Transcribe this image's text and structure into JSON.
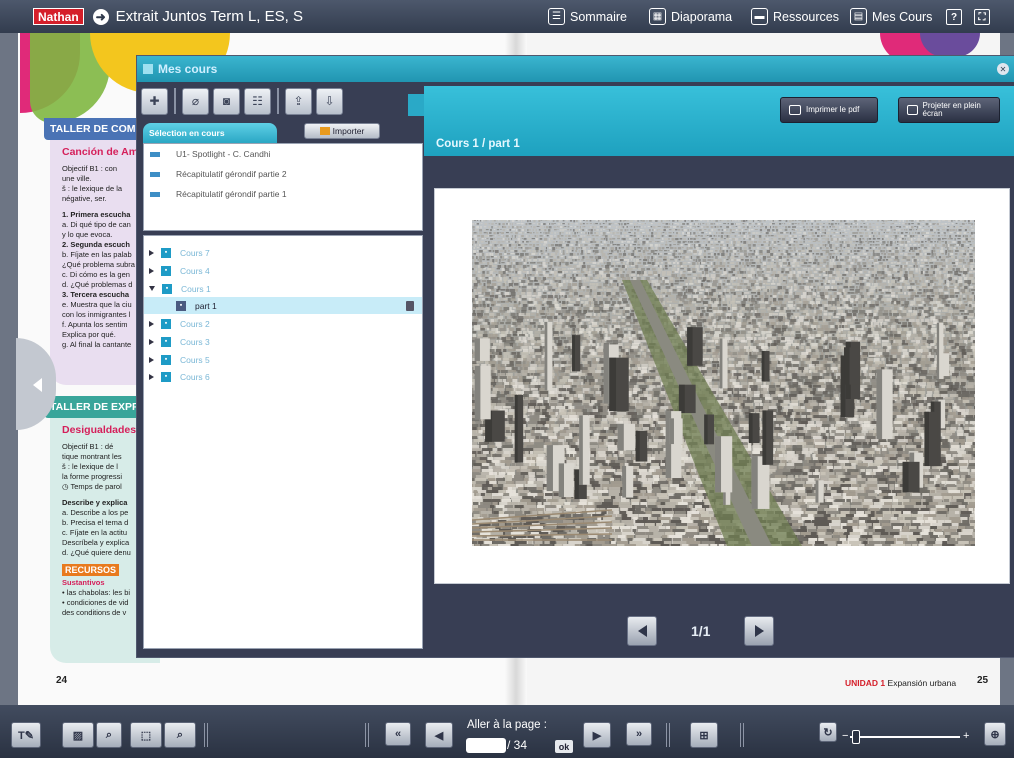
{
  "topbar": {
    "logo": "Nathan",
    "title": "Extrait Juntos Term L, ES, S",
    "nav": [
      {
        "label": "Sommaire",
        "icon": "list-icon"
      },
      {
        "label": "Diaporama",
        "icon": "slideshow-icon"
      },
      {
        "label": "Ressources",
        "icon": "folder-icon"
      },
      {
        "label": "Mes Cours",
        "icon": "courses-icon"
      }
    ],
    "help": "?",
    "fullscreen": "fullscreen-icon"
  },
  "book": {
    "left_page": {
      "taller_comp": "TALLER DE COMP",
      "cancion": "Canción de Am",
      "lines_a": [
        "Objectif B1 : con",
        "une ville.",
        "š : le lexique de la",
        "négative, ser.",
        "",
        "1. Primera escucha",
        "a. Di qué tipo de can",
        "y lo que evoca.",
        "2. Segunda escuch",
        "b. Fíjate en las palab",
        "¿Qué problema subra",
        "c. Di cómo es la gen",
        "d. ¿Qué problemas d",
        "3. Tercera escucha",
        "e. Muestra que la ciu",
        "con los inmigrantes l",
        "f. Apunta los sentim",
        "Explica por qué.",
        "g. Al final la cantante"
      ],
      "taller_expr": "TALLER DE EXPRI",
      "desigualdades": "Desigualdades",
      "lines_b": [
        "Objectif B1 : dé",
        "tique montrant les",
        "š : le lexique de l",
        "la forme progressi",
        "◷ Temps de parol",
        "",
        "Describe y explica",
        "a. Describe a los pe",
        "b. Precisa el tema d",
        "c. Fíjate en la actitu",
        "Descríbela y explica",
        "d. ¿Qué quiere denu"
      ],
      "recursos": "RECURSOS",
      "sustantivos": [
        "Sustantivos",
        "• las chabolas: les bi",
        "• condiciones de vid",
        "  des conditions de v"
      ],
      "page_number": "24"
    },
    "right_page": {
      "unidad_label": "UNIDAD 1",
      "unidad_text": "Expansión urbana",
      "page_number": "25"
    }
  },
  "window": {
    "title": "Mes cours",
    "toolbar": [
      "add-course-icon",
      "attach-icon",
      "camera-icon",
      "edit-icon",
      "export-icon",
      "import-file-icon"
    ],
    "selection_tab": "Sélection en cours",
    "importer": "Importer",
    "selection_items": [
      "U1- Spotlight - C. Candhi",
      "Récapitulatif gérondif partie 2",
      "Récapitulatif gérondif partie 1"
    ],
    "tree": [
      {
        "label": "Cours 7",
        "expanded": false,
        "selected": false,
        "level": 0
      },
      {
        "label": "Cours 4",
        "expanded": false,
        "selected": false,
        "level": 0
      },
      {
        "label": "Cours 1",
        "expanded": true,
        "selected": false,
        "level": 0
      },
      {
        "label": "part 1",
        "expanded": false,
        "selected": true,
        "level": 1
      },
      {
        "label": "Cours 2",
        "expanded": false,
        "selected": false,
        "level": 0
      },
      {
        "label": "Cours 3",
        "expanded": false,
        "selected": false,
        "level": 0
      },
      {
        "label": "Cours 5",
        "expanded": false,
        "selected": false,
        "level": 0
      },
      {
        "label": "Cours 6",
        "expanded": false,
        "selected": false,
        "level": 0
      }
    ],
    "course_path": "Cours 1 / part 1",
    "print_label": "Imprimer le pdf",
    "project_label": "Projeter en plein écran",
    "pager": "1/1"
  },
  "bottombar": {
    "goto_label": "Aller à la page :",
    "page_value": "",
    "page_total": "/ 34",
    "ok_label": "ok"
  }
}
